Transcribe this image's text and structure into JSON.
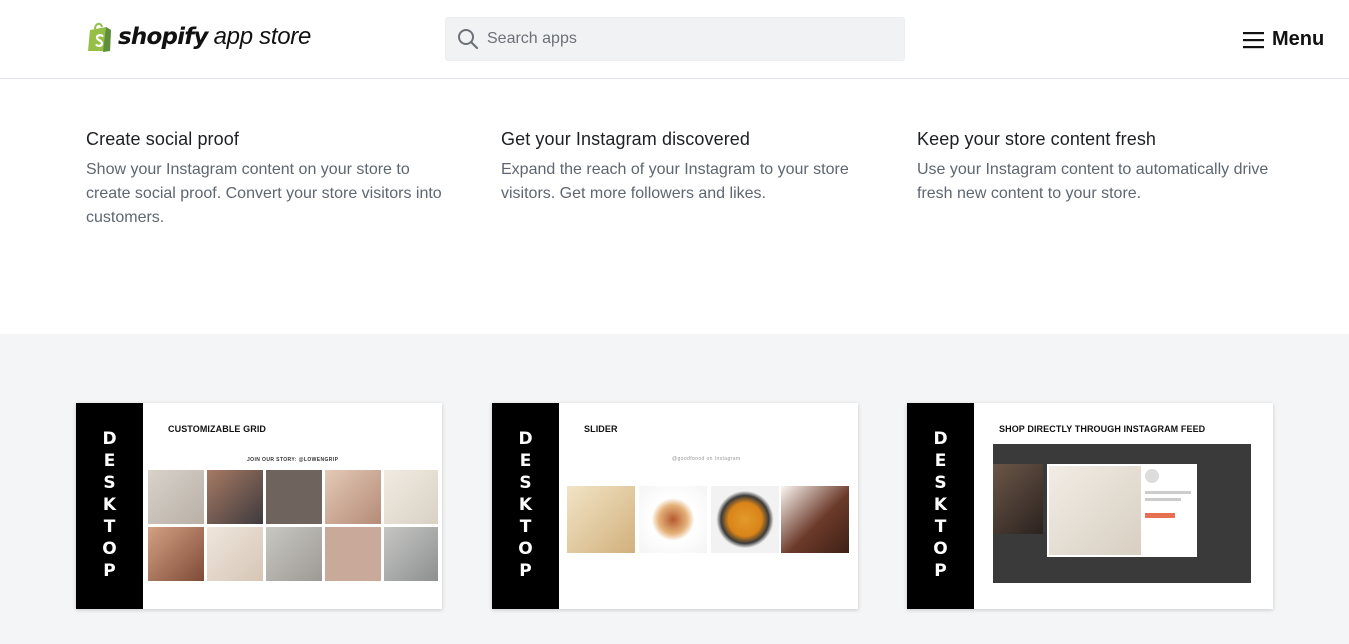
{
  "header": {
    "logo": {
      "wordmark": "shopify",
      "suffix": "app store",
      "brand_color": "#95bf47"
    },
    "search": {
      "placeholder": "Search apps",
      "value": "",
      "icon": "search-icon"
    },
    "menu": {
      "label": "Menu",
      "icon": "hamburger-icon"
    }
  },
  "features": [
    {
      "title": "Create social proof",
      "text": "Show your Instagram content on your store to create social proof. Convert your store visitors into customers."
    },
    {
      "title": "Get your Instagram discovered",
      "text": "Expand the reach of your Instagram to your store visitors. Get more followers and likes."
    },
    {
      "title": "Keep your store content fresh",
      "text": "Use your Instagram content to automatically drive fresh new content to your store."
    }
  ],
  "screenshots": [
    {
      "side_label": "DESKTOP",
      "title": "CUSTOMIZABLE GRID",
      "subtitle": "JOIN OUR STORY: @LOWENGRIP"
    },
    {
      "side_label": "DESKTOP",
      "title": "SLIDER",
      "subtitle": "@goodfoood on Instagram"
    },
    {
      "side_label": "DESKTOP",
      "title": "SHOP DIRECTLY THROUGH INSTAGRAM FEED"
    }
  ],
  "colors": {
    "gallery_bg": "#f4f5f6",
    "card_side": "#000000",
    "body_text": "#5e666f"
  }
}
